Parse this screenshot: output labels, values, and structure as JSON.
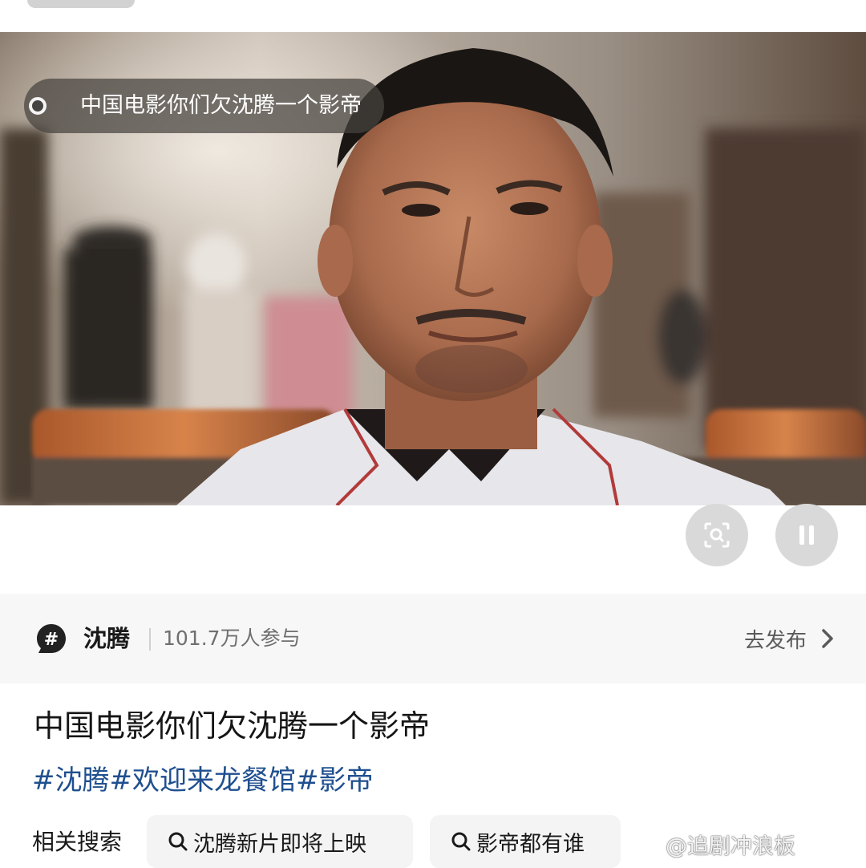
{
  "video": {
    "caption": "中国电影你们欠沈腾一个影帝"
  },
  "controls": {
    "lens_icon": "image-search-icon",
    "pause_icon": "pause-icon"
  },
  "topic": {
    "icon": "hashtag-bubble-icon",
    "name": "沈腾",
    "participants": "101.7万人参与",
    "publish_label": "去发布",
    "publish_icon": "chevron-right-icon"
  },
  "post": {
    "title": "中国电影你们欠沈腾一个影帝",
    "hashtags": [
      "#沈腾",
      "#欢迎来龙餐馆",
      "#影帝"
    ]
  },
  "related": {
    "label": "相关搜索",
    "items": [
      "沈腾新片即将上映",
      "影帝都有谁"
    ]
  },
  "watermark": "@追剧冲浪板",
  "colors": {
    "hashtag": "#1f4f8f",
    "topic_bar_bg": "#f7f7f7",
    "chip_bg": "#f4f4f4"
  }
}
